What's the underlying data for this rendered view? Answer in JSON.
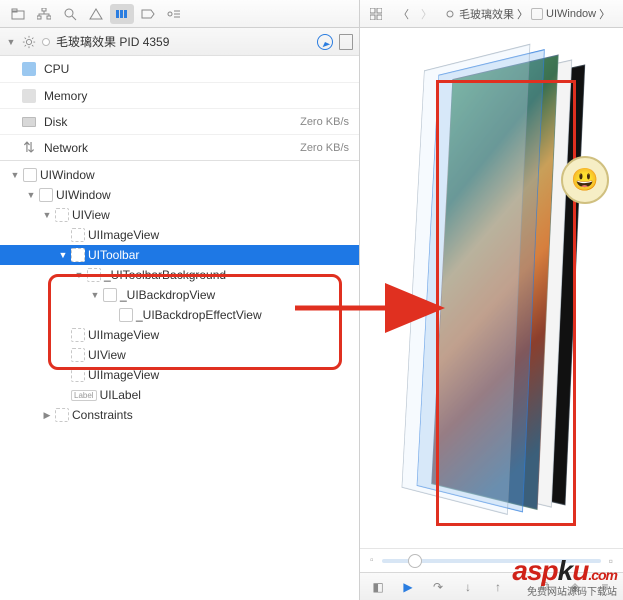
{
  "app": {
    "title_prefix": "毛玻璃效果",
    "pid_label": "PID 4359"
  },
  "stats": [
    {
      "id": "cpu",
      "label": "CPU",
      "value": ""
    },
    {
      "id": "memory",
      "label": "Memory",
      "value": ""
    },
    {
      "id": "disk",
      "label": "Disk",
      "value": "Zero KB/s"
    },
    {
      "id": "network",
      "label": "Network",
      "value": "Zero KB/s"
    }
  ],
  "tree": [
    {
      "indent": 0,
      "arrow": "▼",
      "icon": "plain",
      "label": "UIWindow"
    },
    {
      "indent": 1,
      "arrow": "▼",
      "icon": "plain",
      "label": "UIWindow"
    },
    {
      "indent": 2,
      "arrow": "▼",
      "icon": "dotted",
      "label": "UIView"
    },
    {
      "indent": 3,
      "arrow": "",
      "icon": "dotted",
      "label": "UIImageView"
    },
    {
      "indent": 3,
      "arrow": "▼",
      "icon": "dotted",
      "label": "UIToolbar",
      "selected": true
    },
    {
      "indent": 4,
      "arrow": "▼",
      "icon": "dotted",
      "label": "_UIToolbarBackground"
    },
    {
      "indent": 5,
      "arrow": "▼",
      "icon": "plain",
      "label": "_UIBackdropView"
    },
    {
      "indent": 6,
      "arrow": "",
      "icon": "plain",
      "label": "_UIBackdropEffectView"
    },
    {
      "indent": 3,
      "arrow": "",
      "icon": "dotted",
      "label": "UIImageView"
    },
    {
      "indent": 3,
      "arrow": "",
      "icon": "dotted",
      "label": "UIView"
    },
    {
      "indent": 3,
      "arrow": "",
      "icon": "dotted",
      "label": "UIImageView"
    },
    {
      "indent": 3,
      "arrow": "",
      "icon": "label",
      "label": "UILabel"
    },
    {
      "indent": 2,
      "arrow": "▶",
      "icon": "dotted",
      "label": "Constraints"
    }
  ],
  "breadcrumb": [
    {
      "icon": "gear",
      "label": "毛玻璃效果"
    },
    {
      "icon": "box",
      "label": "UIWindow"
    }
  ],
  "watermark": {
    "main_a": "asp",
    "main_k": "k",
    "main_u": "u",
    "dotcom": ".com",
    "sub": "免费网站源码下载站"
  }
}
